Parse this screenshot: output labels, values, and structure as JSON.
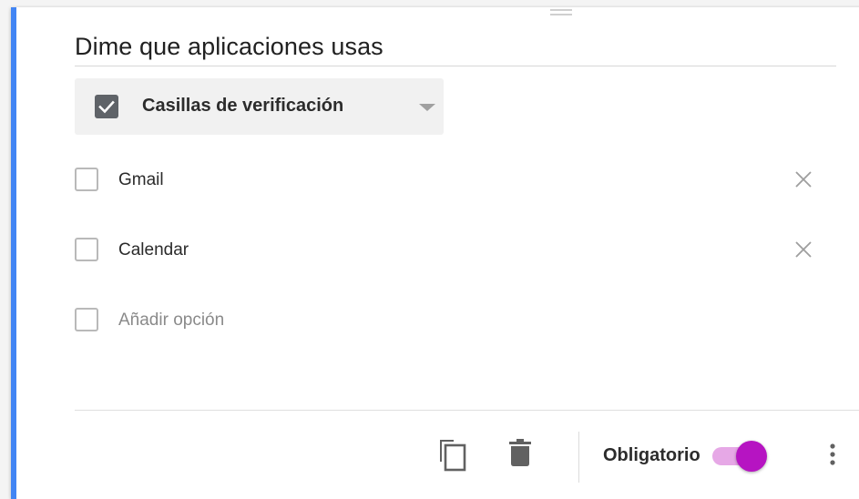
{
  "question": {
    "title": "Dime que aplicaciones usas",
    "type_label": "Casillas de verificación",
    "type_icon": "checkbox-checked-icon",
    "options": [
      {
        "label": "Gmail"
      },
      {
        "label": "Calendar"
      }
    ],
    "add_option_placeholder": "Añadir opción"
  },
  "footer": {
    "duplicate_icon": "copy-icon",
    "delete_icon": "trash-icon",
    "required_label": "Obligatorio",
    "required_on": true,
    "more_icon": "more-vert-icon"
  },
  "colors": {
    "accent": "#4285f4",
    "toggle_thumb": "#b614c2",
    "toggle_track": "#e6a8e6"
  }
}
